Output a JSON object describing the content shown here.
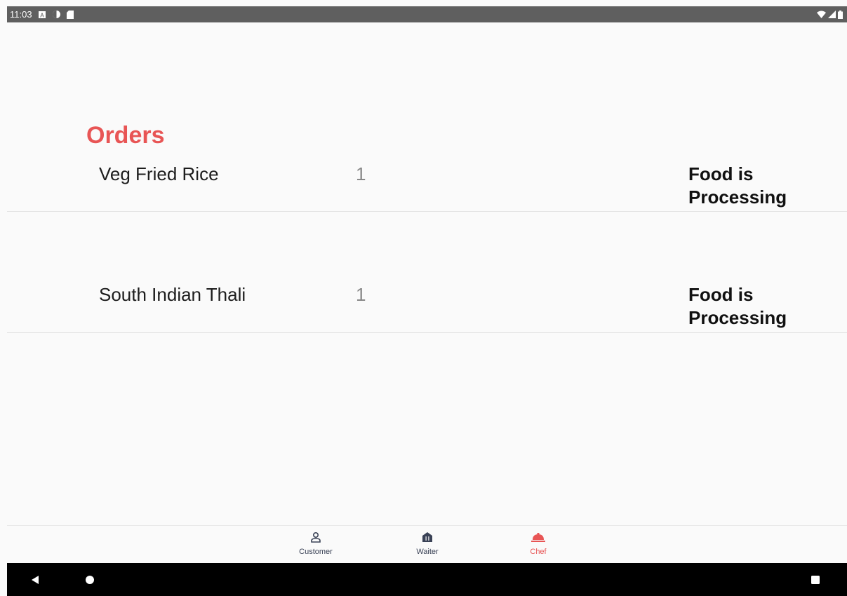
{
  "status_bar": {
    "time": "11:03",
    "left_icons": [
      "a-notification-icon",
      "data-saver-icon",
      "sd-card-icon"
    ],
    "right_icons": [
      "wifi-icon",
      "signal-icon",
      "battery-icon"
    ]
  },
  "page": {
    "title": "Orders"
  },
  "orders": [
    {
      "name": "Veg Fried Rice",
      "quantity": "1",
      "status": "Food is Processing"
    },
    {
      "name": "South Indian Thali",
      "quantity": "1",
      "status": "Food is Processing"
    }
  ],
  "bottom_nav": {
    "items": [
      {
        "label": "Customer",
        "icon": "person-icon",
        "active": false
      },
      {
        "label": "Waiter",
        "icon": "restaurant-icon",
        "active": false
      },
      {
        "label": "Chef",
        "icon": "cloche-icon",
        "active": true
      }
    ]
  },
  "colors": {
    "accent": "#e85555",
    "nav_default": "#3a4256",
    "status_bar": "#5f5f5f",
    "system_nav": "#000000"
  },
  "system_nav": {
    "icons": [
      "back-icon",
      "home-icon",
      "recents-icon"
    ]
  }
}
